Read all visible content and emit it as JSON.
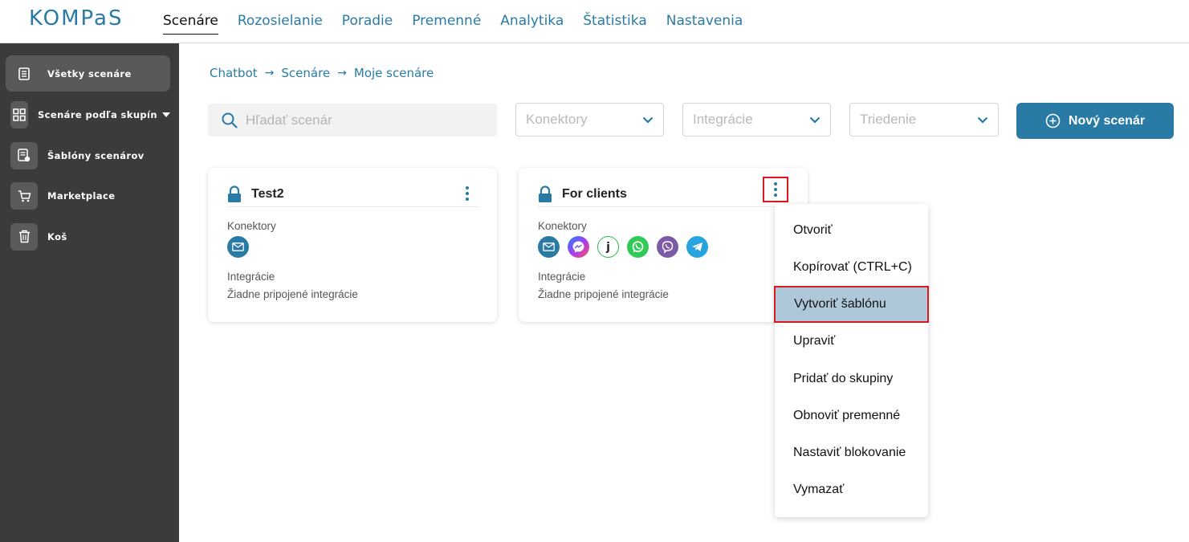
{
  "brand": {
    "logo_text": "KOMPaS",
    "accent": "#2a7aa6"
  },
  "nav": {
    "items": [
      {
        "label": "Scenáre",
        "active": true
      },
      {
        "label": "Rozosielanie"
      },
      {
        "label": "Poradie"
      },
      {
        "label": "Premenné"
      },
      {
        "label": "Analytika"
      },
      {
        "label": "Štatistika"
      },
      {
        "label": "Nastavenia"
      }
    ]
  },
  "sidebar": {
    "items": [
      {
        "label": "Všetky scenáre",
        "icon": "document-icon",
        "active": true
      },
      {
        "label": "Scenáre podľa skupín",
        "icon": "grid-icon"
      },
      {
        "label": "Šablóny scenárov",
        "icon": "template-icon"
      },
      {
        "label": "Marketplace",
        "icon": "cart-icon"
      },
      {
        "label": "Koš",
        "icon": "trash-icon"
      }
    ]
  },
  "breadcrumb": [
    "Chatbot",
    "Scenáre",
    "Moje scenáre"
  ],
  "filters": {
    "search_placeholder": "Hľadať scenár",
    "connectors": "Konektory",
    "integrations": "Integrácie",
    "sorting": "Triedenie",
    "new_button": "Nový scenár"
  },
  "cards": [
    {
      "title": "Test2",
      "connectors_label": "Konektory",
      "connectors": [
        "email-icon"
      ],
      "integrations_label": "Integrácie",
      "integrations_value": "Žiadne pripojené integrácie"
    },
    {
      "title": "For clients",
      "connectors_label": "Konektory",
      "connectors": [
        "email-icon",
        "messenger-icon",
        "jivo-icon",
        "whatsapp-icon",
        "viber-icon",
        "telegram-icon"
      ],
      "integrations_label": "Integrácie",
      "integrations_value": "Žiadne pripojené integrácie"
    }
  ],
  "menu": {
    "items": [
      "Otvoriť",
      "Kopírovať (CTRL+C)",
      "Vytvoriť šablónu",
      "Upraviť",
      "Pridať do skupiny",
      "Obnoviť premenné",
      "Nastaviť blokovanie",
      "Vymazať"
    ],
    "highlighted": "Vytvoriť šablónu"
  }
}
